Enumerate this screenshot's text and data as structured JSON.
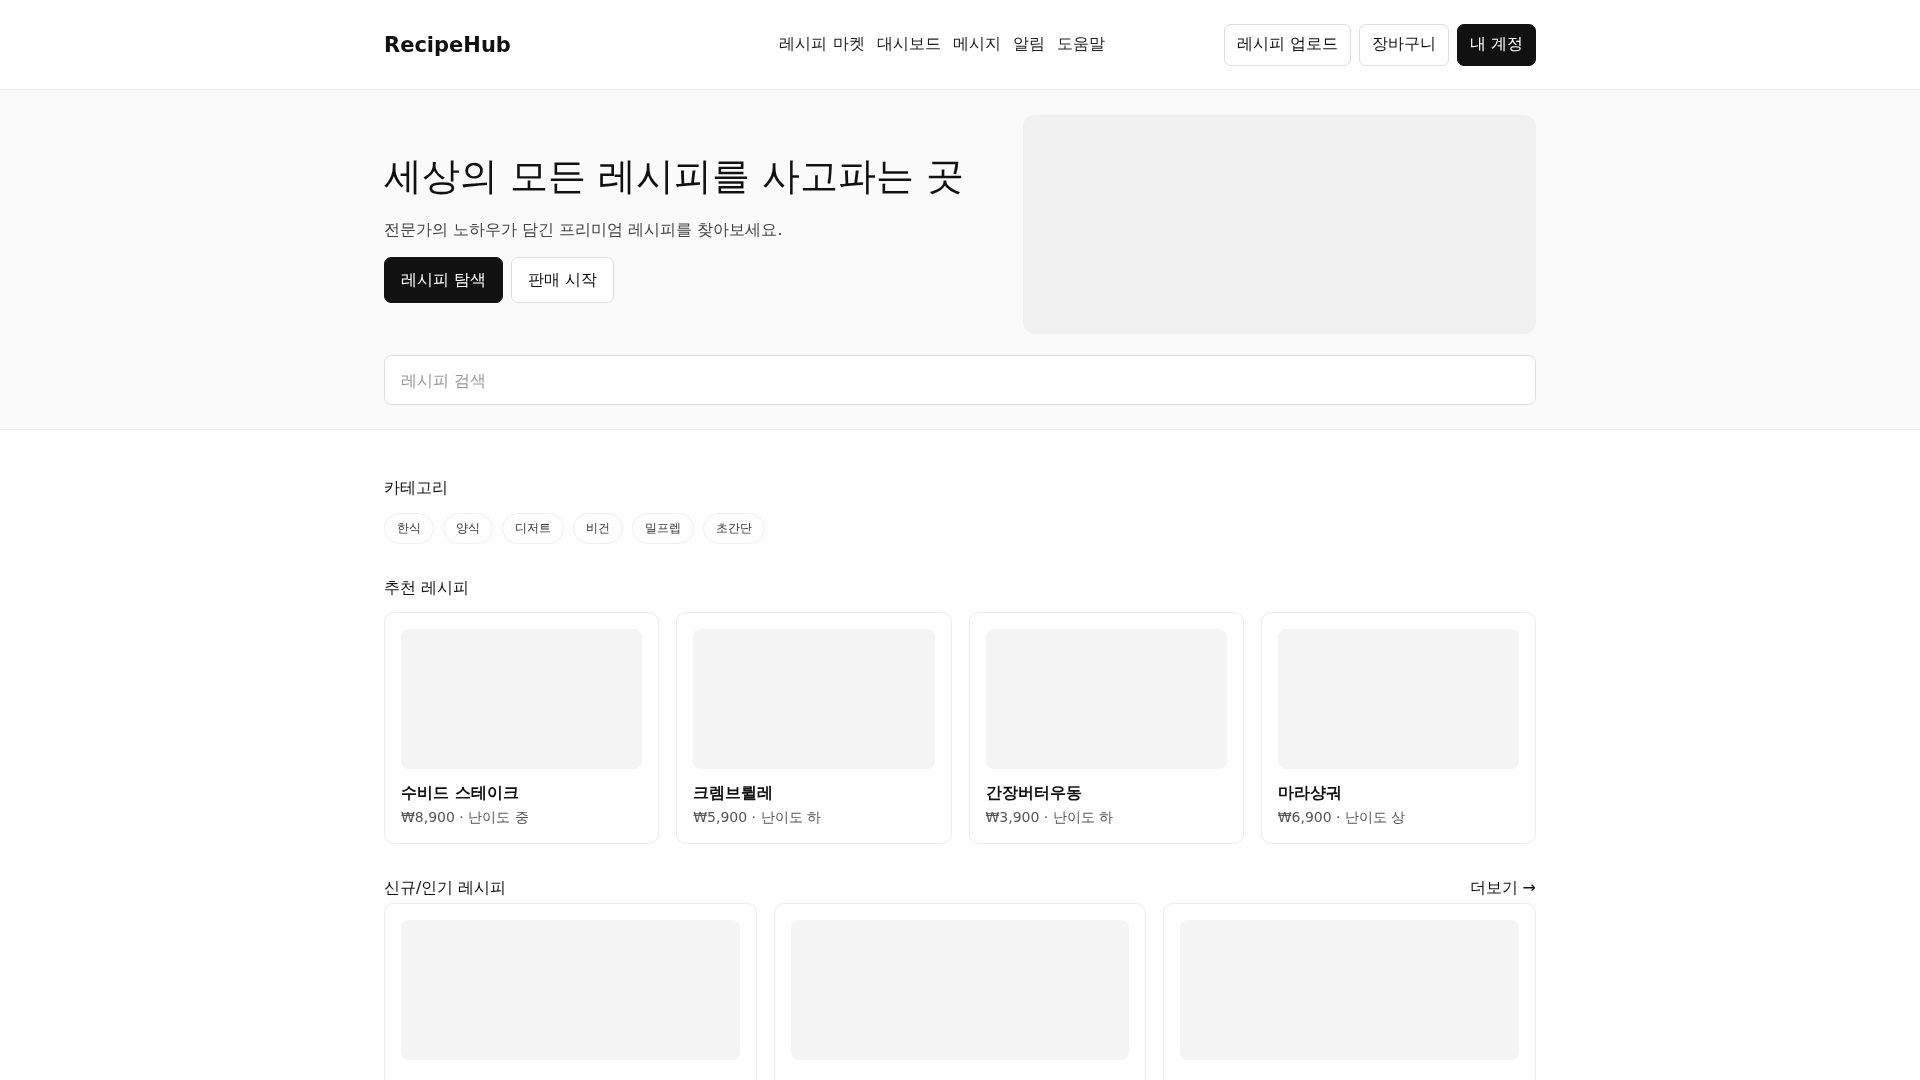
{
  "header": {
    "logo": "RecipeHub",
    "nav": [
      "레시피 마켓",
      "대시보드",
      "메시지",
      "알림",
      "도움말"
    ],
    "actions": [
      {
        "label": "레시피 업로드",
        "primary": false
      },
      {
        "label": "장바구니",
        "primary": false
      },
      {
        "label": "내 계정",
        "primary": true
      }
    ]
  },
  "hero": {
    "title": "세상의 모든 레시피를 사고파는 곳",
    "subtitle": "전문가의 노하우가 담긴 프리미엄 레시피를 찾아보세요.",
    "buttons": [
      {
        "label": "레시피 탐색",
        "primary": true
      },
      {
        "label": "판매 시작",
        "primary": false
      }
    ],
    "image": {
      "kind": "image_placeholder"
    }
  },
  "search": {
    "placeholder": "레시피 검색"
  },
  "categories": {
    "title": "카테고리",
    "items": [
      "한식",
      "양식",
      "디저트",
      "비건",
      "밀프렙",
      "초간단"
    ]
  },
  "featured": {
    "title": "추천 레시피",
    "cards": [
      {
        "name": "수비드 스테이크",
        "meta": "₩8,900 · 난이도 중"
      },
      {
        "name": "크렘브륄레",
        "meta": "₩5,900 · 난이도 하"
      },
      {
        "name": "간장버터우동",
        "meta": "₩3,900 · 난이도 하"
      },
      {
        "name": "마라샹궈",
        "meta": "₩6,900 · 난이도 상"
      }
    ]
  },
  "new_popular": {
    "title": "신규/인기 레시피",
    "more": "더보기 →",
    "cards": [
      {
        "kind": "image_placeholder"
      },
      {
        "kind": "image_placeholder"
      },
      {
        "kind": "image_placeholder"
      }
    ]
  }
}
